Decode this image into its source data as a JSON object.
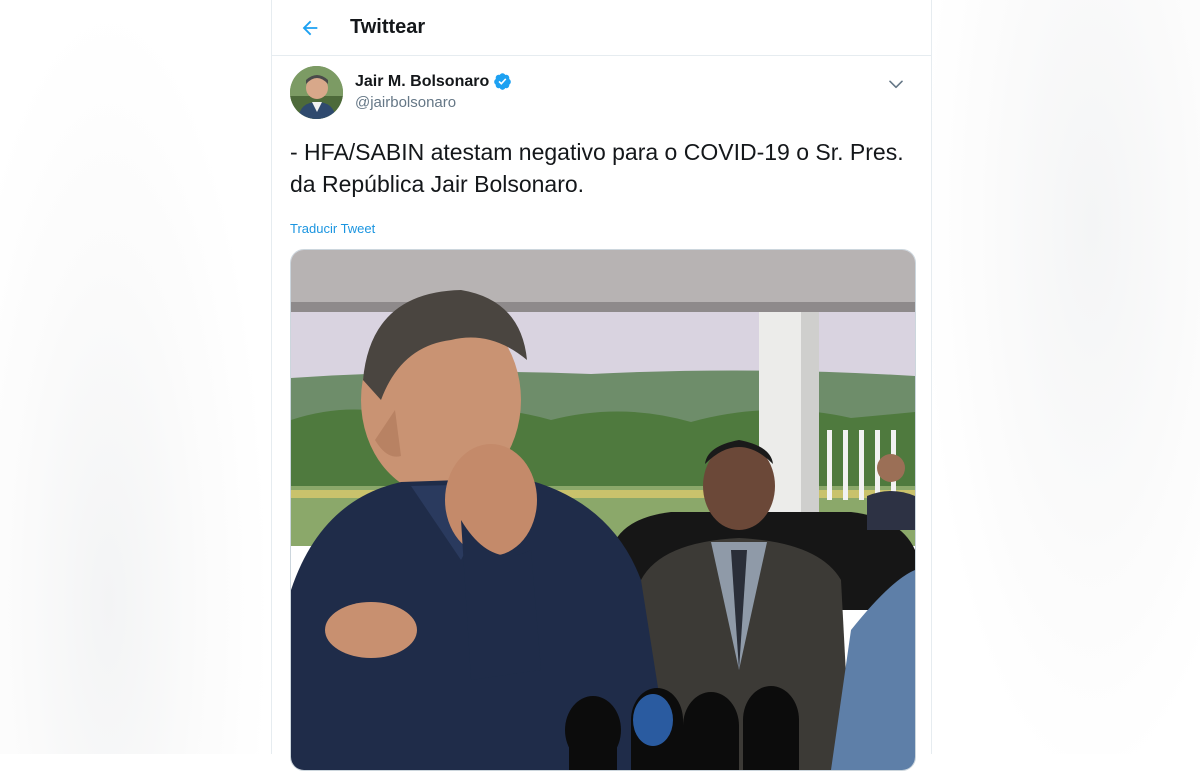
{
  "header": {
    "title": "Twittear",
    "back_icon": "arrow-left-icon"
  },
  "tweet": {
    "author": {
      "display_name": "Jair M. Bolsonaro",
      "handle": "@jairbolsonaro",
      "verified": true
    },
    "text": "- HFA/SABIN atestam negativo para o COVID-19 o Sr. Pres. da República Jair Bolsonaro.",
    "translate_label": "Traducir Tweet",
    "more_icon": "chevron-down-icon",
    "media": {
      "type": "photo"
    }
  },
  "colors": {
    "accent": "#1da1f2",
    "link": "#1b95e0",
    "text": "#14171a",
    "secondary": "#657786",
    "border": "#e6ecf0"
  }
}
